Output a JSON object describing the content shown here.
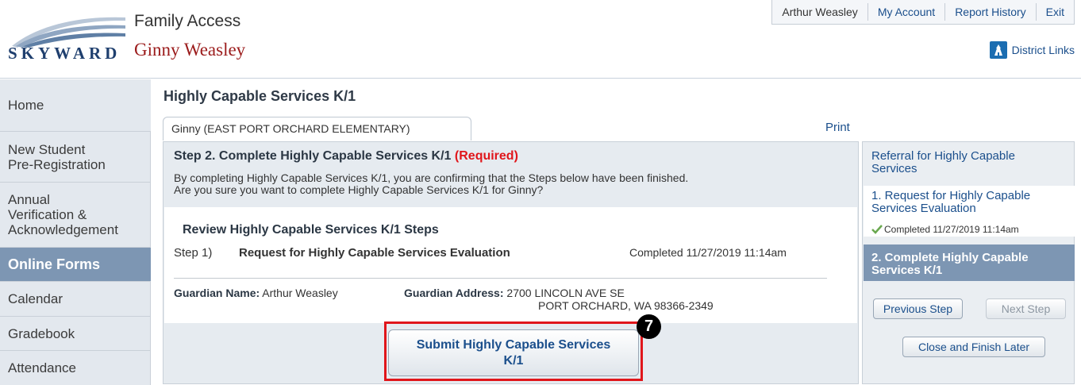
{
  "header": {
    "logo_text": "SKYWARD",
    "app_title": "Family Access",
    "student_name": "Ginny Weasley",
    "topnav": [
      "Arthur Weasley",
      "My Account",
      "Report History",
      "Exit"
    ],
    "district_links": "District Links"
  },
  "sidebar": {
    "items": [
      {
        "label": "Home"
      },
      {
        "label": "New Student\nPre-Registration"
      },
      {
        "label": "Annual\nVerification &\nAcknowledgement"
      },
      {
        "label": "Online Forms",
        "active": true
      },
      {
        "label": "Calendar"
      },
      {
        "label": "Gradebook"
      },
      {
        "label": "Attendance"
      }
    ]
  },
  "main": {
    "page_title": "Highly Capable Services K/1",
    "tab_label": "Ginny (EAST PORT ORCHARD ELEMENTARY)",
    "print_label": "Print",
    "step_heading": "Step 2. Complete Highly Capable Services K/1",
    "required_label": "(Required)",
    "confirm_line1": "By completing Highly Capable Services K/1, you are confirming that the Steps below have been finished.",
    "confirm_line2": "Are you sure you want to complete Highly Capable Services K/1 for Ginny?",
    "review_title": "Review Highly Capable Services K/1 Steps",
    "steps": [
      {
        "num": "Step 1)",
        "name": "Request for Highly Capable Services Evaluation",
        "status": "Completed 11/27/2019 11:14am"
      }
    ],
    "guardian_name_label": "Guardian Name:",
    "guardian_name": "Arthur Weasley",
    "guardian_address_label": "Guardian Address:",
    "guardian_address_line1": "2700 LINCOLN AVE SE",
    "guardian_address_line2": "PORT ORCHARD, WA 98366-2349",
    "submit_label_line1": "Submit Highly Capable Services",
    "submit_label_line2": "K/1",
    "badge": "7"
  },
  "right_panel": {
    "title": "Referral for Highly Capable Services",
    "step1_label": "1. Request for Highly Capable Services Evaluation",
    "step1_status": "Completed 11/27/2019 11:14am",
    "step2_label": "2. Complete Highly Capable Services K/1",
    "previous_step": "Previous Step",
    "next_step": "Next Step",
    "close_finish": "Close and Finish Later"
  },
  "colors": {
    "accent_blue": "#1b4f8c",
    "active_nav": "#7d96b3",
    "required_red": "#e0161b",
    "student_name_red": "#9b1b1b"
  }
}
